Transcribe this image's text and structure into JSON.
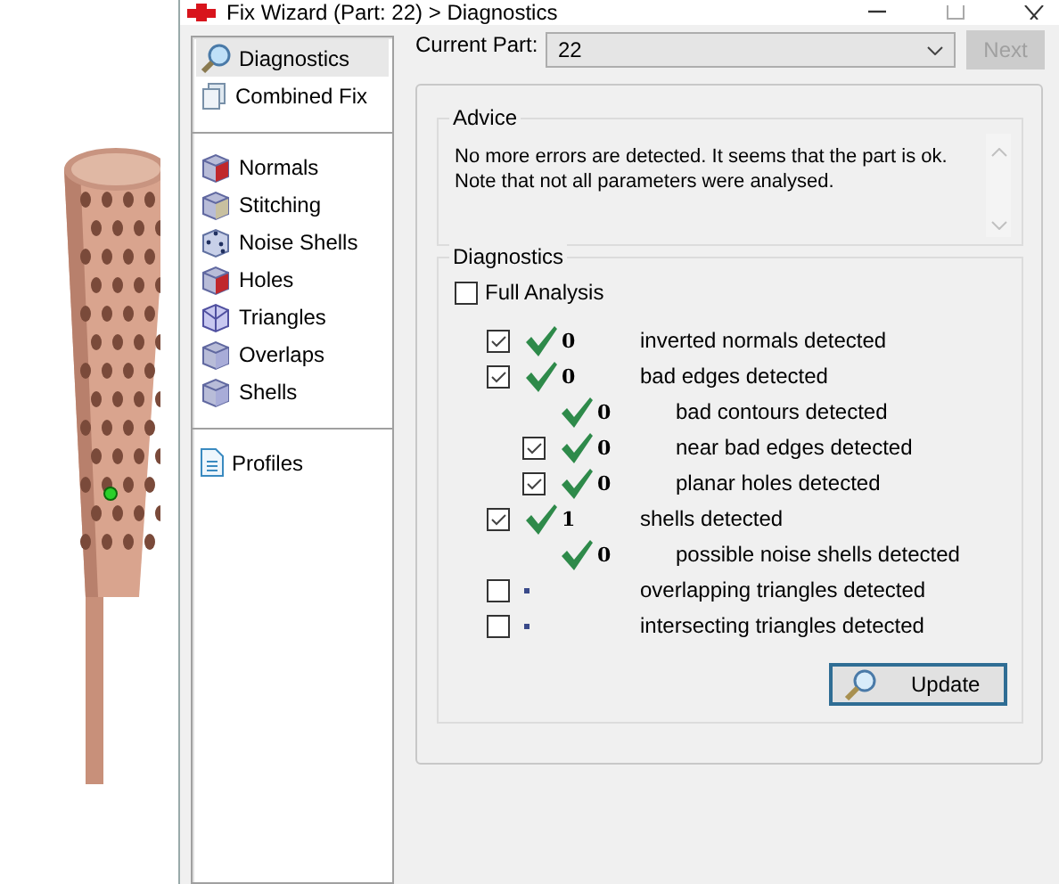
{
  "window": {
    "title": "Fix Wizard (Part: 22) > Diagnostics"
  },
  "sidebar": {
    "groups": [
      [
        {
          "label": "Diagnostics",
          "selected": true
        },
        {
          "label": "Combined Fix",
          "selected": false
        }
      ],
      [
        {
          "label": "Normals",
          "selected": false
        },
        {
          "label": "Stitching",
          "selected": false
        },
        {
          "label": "Noise Shells",
          "selected": false
        },
        {
          "label": "Holes",
          "selected": false
        },
        {
          "label": "Triangles",
          "selected": false
        },
        {
          "label": "Overlaps",
          "selected": false
        },
        {
          "label": "Shells",
          "selected": false
        }
      ],
      [
        {
          "label": "Profiles",
          "selected": false
        }
      ]
    ]
  },
  "current_part": {
    "label": "Current Part:",
    "value": "22"
  },
  "next_button": {
    "label": "Next",
    "disabled": true
  },
  "advice": {
    "title": "Advice",
    "text": "No more errors are detected. It seems that the part is ok.\nNote that not all parameters were analysed."
  },
  "diagnostics": {
    "title": "Diagnostics",
    "full_analysis": {
      "label": "Full Analysis",
      "checked": false
    },
    "rows": [
      {
        "kind": "checkbox",
        "checked": true,
        "passed": true,
        "count": "0",
        "label": "inverted normals detected"
      },
      {
        "kind": "checkbox",
        "checked": true,
        "passed": true,
        "count": "0",
        "label": "bad edges detected",
        "children": [
          {
            "kind": "plain",
            "passed": true,
            "count": "0",
            "label": "bad contours detected"
          },
          {
            "kind": "checkbox",
            "checked": true,
            "passed": true,
            "count": "0",
            "label": "near bad edges detected"
          },
          {
            "kind": "checkbox",
            "checked": true,
            "passed": true,
            "count": "0",
            "label": "planar holes detected"
          }
        ]
      },
      {
        "kind": "checkbox",
        "checked": true,
        "passed": true,
        "count": "1",
        "label": "shells detected",
        "children": [
          {
            "kind": "plain",
            "passed": true,
            "count": "0",
            "label": "possible noise shells detected"
          }
        ]
      },
      {
        "kind": "checkbox",
        "checked": false,
        "passed": false,
        "label": "overlapping triangles detected"
      },
      {
        "kind": "checkbox",
        "checked": false,
        "passed": false,
        "label": "intersecting triangles detected"
      }
    ]
  },
  "update_button": {
    "label": "Update"
  }
}
